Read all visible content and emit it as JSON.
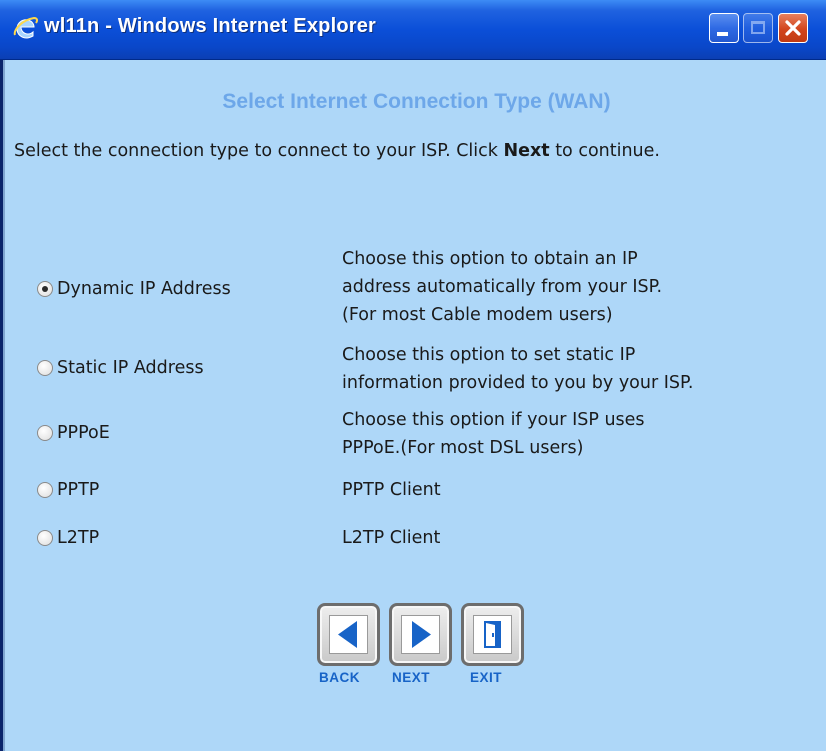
{
  "window": {
    "title": "wl11n - Windows Internet Explorer"
  },
  "page": {
    "heading": "Select Internet Connection Type (WAN)",
    "intro_before": "Select the connection type to connect to your ISP. Click ",
    "intro_bold": "Next",
    "intro_after": " to continue."
  },
  "options": [
    {
      "label": "Dynamic IP Address",
      "selected": true,
      "desc": [
        "Choose this option to obtain an IP",
        "address automatically from your ISP.",
        "(For most Cable modem users)"
      ]
    },
    {
      "label": "Static IP Address",
      "selected": false,
      "desc": [
        "Choose this option to set static IP",
        "information provided to you by your ISP."
      ]
    },
    {
      "label": "PPPoE",
      "selected": false,
      "desc": [
        "Choose this option if your ISP uses",
        "PPPoE.(For most DSL users)"
      ]
    },
    {
      "label": "PPTP",
      "selected": false,
      "desc": [
        "PPTP Client"
      ]
    },
    {
      "label": "L2TP",
      "selected": false,
      "desc": [
        "L2TP Client"
      ]
    }
  ],
  "nav": {
    "back_label": "BACK",
    "next_label": "NEXT",
    "exit_label": "EXIT"
  },
  "colors": {
    "page_bg": "#aed7f8",
    "heading": "#6da7e9",
    "nav_accent": "#1763c7"
  }
}
